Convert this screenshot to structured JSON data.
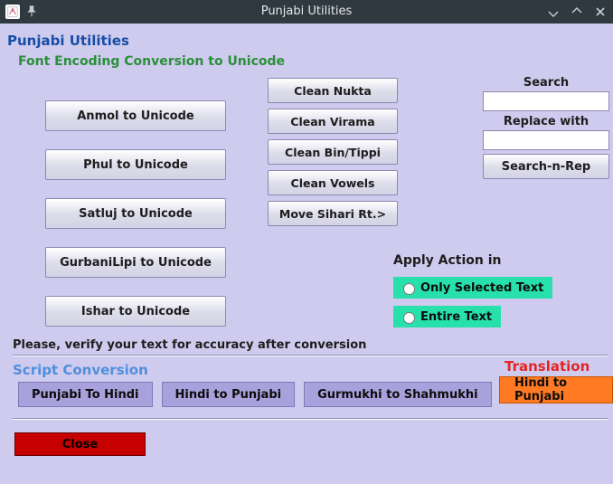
{
  "window": {
    "title": "Punjabi Utilities"
  },
  "header": {
    "app_title": "Punjabi Utilities",
    "section_title": "Font Encoding Conversion to Unicode"
  },
  "font_conversion_buttons": [
    "Anmol to Unicode",
    "Phul to Unicode",
    "Satluj to Unicode",
    "GurbaniLipi to Unicode",
    "Ishar to Unicode"
  ],
  "cleanup_buttons": [
    "Clean Nukta",
    "Clean Virama",
    "Clean Bin/Tippi",
    "Clean Vowels",
    "Move Sihari Rt.>"
  ],
  "search_replace": {
    "search_label": "Search",
    "search_value": "",
    "replace_label": "Replace with",
    "replace_value": "",
    "button_label": "Search-n-Rep"
  },
  "apply_action": {
    "title": "Apply Action in",
    "options": [
      {
        "label": "Only Selected Text",
        "selected": false
      },
      {
        "label": "Entire Text",
        "selected": false
      }
    ]
  },
  "verify_note": "Please, verify your text for accuracy after conversion",
  "script_conversion": {
    "title": "Script Conversion",
    "buttons": [
      "Punjabi To Hindi",
      "Hindi to Punjabi",
      "Gurmukhi to Shahmukhi"
    ]
  },
  "translation": {
    "title": "Translation",
    "button": "Hindi to Punjabi"
  },
  "close_label": "Close"
}
